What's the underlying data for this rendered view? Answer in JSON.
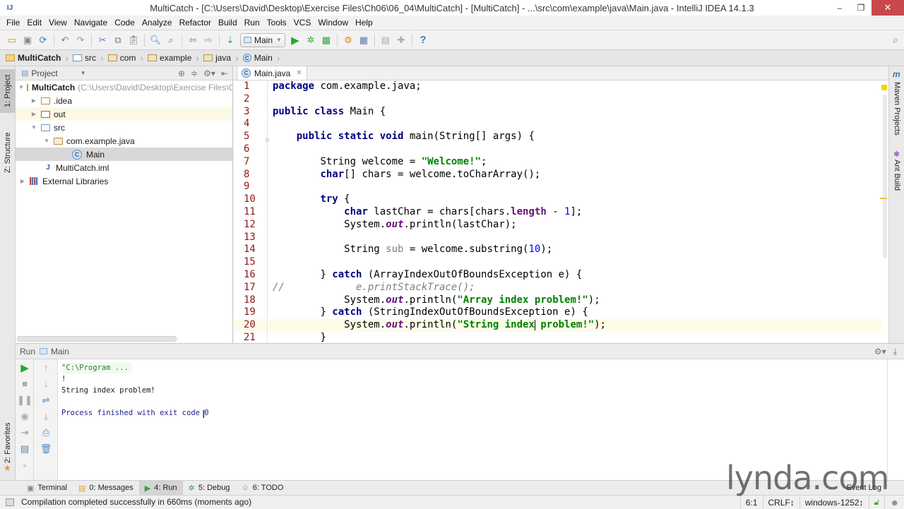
{
  "window": {
    "title": "MultiCatch - [C:\\Users\\David\\Desktop\\Exercise Files\\Ch06\\06_04\\MultiCatch] - [MultiCatch] - ...\\src\\com\\example\\java\\Main.java - IntelliJ IDEA 14.1.3",
    "minimize": "–",
    "maximize": "❐",
    "close": "✕"
  },
  "menu": [
    "File",
    "Edit",
    "View",
    "Navigate",
    "Code",
    "Analyze",
    "Refactor",
    "Build",
    "Run",
    "Tools",
    "VCS",
    "Window",
    "Help"
  ],
  "toolbar": {
    "run_config": "Main",
    "icons": [
      "open-icon",
      "save-icon",
      "sync-icon",
      "undo-icon",
      "redo-icon",
      "cut-icon",
      "copy-icon",
      "paste-icon",
      "find-icon",
      "replace-icon",
      "back-icon",
      "forward-icon",
      "make-icon",
      "run-icon",
      "debug-icon",
      "coverage-icon",
      "project-structure-icon",
      "sdk-icon",
      "android-sdk-icon",
      "android-device-icon",
      "help-icon"
    ]
  },
  "breadcrumb": [
    "MultiCatch",
    "src",
    "com",
    "example",
    "java",
    "Main"
  ],
  "left_strip": {
    "project": "1: Project",
    "structure": "Z: Structure",
    "favorites": "2: Favorites"
  },
  "right_strip": {
    "maven": "Maven Projects",
    "ant": "Ant Build"
  },
  "project_panel": {
    "title": "Project",
    "tree": [
      {
        "label": "MultiCatch",
        "hint": "(C:\\Users\\David\\Desktop\\Exercise Files\\Ch",
        "bold": true
      },
      {
        "label": ".idea"
      },
      {
        "label": "out"
      },
      {
        "label": "src"
      },
      {
        "label": "com.example.java"
      },
      {
        "label": "Main"
      },
      {
        "label": "MultiCatch.iml"
      },
      {
        "label": "External Libraries"
      }
    ]
  },
  "editor": {
    "tab": "Main.java",
    "current_line": 20,
    "line_numbers": [
      "1",
      "2",
      "3",
      "4",
      "5",
      "6",
      "7",
      "8",
      "9",
      "10",
      "11",
      "12",
      "13",
      "14",
      "15",
      "16",
      "17",
      "18",
      "19",
      "20",
      "21"
    ],
    "code": {
      "l1_kw": "package",
      "l1_rest": " com.example.java;",
      "l3_kw": "public class",
      "l3_rest": " Main {",
      "l5_kw": "public static void",
      "l5_rest": " main(String[] args) {",
      "l7_a": "String welcome = ",
      "l7_str": "\"Welcome!\"",
      "l7_b": ";",
      "l8_kw": "char",
      "l8_rest": "[] chars = welcome.toCharArray();",
      "l10_kw": "try",
      "l10_rest": " {",
      "l11_kw": "char",
      "l11_a": " lastChar = chars[chars.",
      "l11_fld": "length",
      "l11_b": " - ",
      "l11_num": "1",
      "l11_c": "];",
      "l12_a": "System.",
      "l12_fld": "out",
      "l12_b": ".println(lastChar);",
      "l14_a": "String ",
      "l14_unused": "sub",
      "l14_b": " = welcome.substring(",
      "l14_num": "10",
      "l14_c": ");",
      "l16_a": "} ",
      "l16_kw": "catch",
      "l16_b": " (ArrayIndexOutOfBoundsException e) {",
      "l17_cmt": "//            e.printStackTrace();",
      "l18_a": "System.",
      "l18_fld": "out",
      "l18_b": ".println(",
      "l18_str": "\"Array index problem!\"",
      "l18_c": ");",
      "l19_a": "} ",
      "l19_kw": "catch",
      "l19_b": " (StringIndexOutOfBoundsException e) {",
      "l20_a": "System.",
      "l20_fld": "out",
      "l20_b": ".println(",
      "l20_str1": "\"String index",
      "l20_str2": " problem!\"",
      "l20_c": ");",
      "l21": "}"
    }
  },
  "run_panel": {
    "label": "Run",
    "config": "Main",
    "console": [
      "\"C:\\Program ...",
      "!",
      "String index problem!",
      "",
      "Process finished with exit code 0"
    ]
  },
  "bottom_tabs": [
    {
      "label": "Terminal"
    },
    {
      "label": "0: Messages"
    },
    {
      "label": "4: Run",
      "active": true
    },
    {
      "label": "5: Debug"
    },
    {
      "label": "6: TODO"
    }
  ],
  "event_log": "Event Log",
  "status": {
    "message": "Compilation completed successfully in 660ms (moments ago)",
    "position": "6:1",
    "line_sep": "CRLF↕",
    "encoding": "windows-1252↕"
  },
  "watermark": "lynda.com"
}
